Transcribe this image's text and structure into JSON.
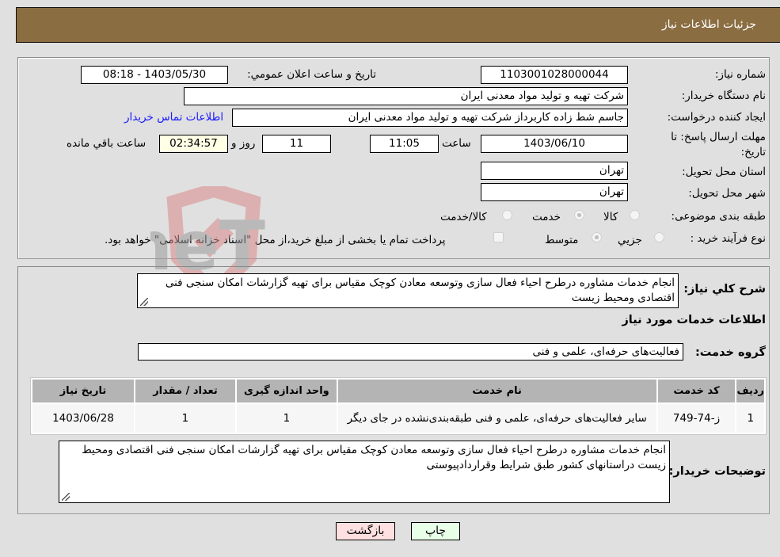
{
  "header": {
    "title": "جزئیات اطلاعات نیاز"
  },
  "fields": {
    "need_number": {
      "label": "شماره نیاز:",
      "value": "1103001028000044"
    },
    "announce_datetime": {
      "label": "تاریخ و ساعت اعلان عمومي:",
      "value": "1403/05/30 - 08:18"
    },
    "buyer_org": {
      "label": "نام دستگاه خریدار:",
      "value": "شرکت تهیه و تولید مواد معدنی ایران"
    },
    "creator": {
      "label": "ایجاد کننده درخواست:",
      "value": "جاسم شط زاده کاربرداز شرکت تهیه و تولید مواد معدنی ایران"
    },
    "buyer_contact_link": "اطلاعات تماس خریدار",
    "deadline": {
      "label": "مهلت ارسال پاسخ: تا تاریخ:",
      "date": "1403/06/10",
      "time_label": "ساعت",
      "time": "11:05",
      "days": "11",
      "days_label": "روز و",
      "remaining": "02:34:57",
      "remaining_label": "ساعت باقي مانده"
    },
    "province": {
      "label": "استان محل تحویل:",
      "value": "تهران"
    },
    "city": {
      "label": "شهر محل تحویل:",
      "value": "تهران"
    },
    "category": {
      "label": "طبقه بندی موضوعی:",
      "options": [
        "کالا",
        "خدمت",
        "کالا/خدمت"
      ],
      "selected": "خدمت"
    },
    "purchase_type": {
      "label": "نوع فرآیند خرید :",
      "options": [
        "جزيي",
        "متوسط"
      ],
      "selected": "متوسط",
      "treasury_note": "پرداخت تمام یا بخشی از مبلغ خرید،از محل \"اسناد خزانه اسلامی\" خواهد بود."
    }
  },
  "description": {
    "label": "شرح کلي نياز:",
    "value": "انجام خدمات مشاوره درطرح احیاء فعال سازی وتوسعه معادن کوچک مقیاس برای تهیه گزارشات امکان سنجی فنی اقتصادی ومحیط زیست"
  },
  "services_section": {
    "title": "اطلاعات خدمات مورد نياز",
    "group_label": "گروه خدمت:",
    "group_value": "فعالیت‌های حرفه‌ای، علمی و فنی",
    "table": {
      "headers": [
        "ردیف",
        "کد خدمت",
        "نام خدمت",
        "واحد اندازه گیری",
        "تعداد / مقدار",
        "تاریخ نیاز"
      ],
      "rows": [
        [
          "1",
          "ز-74-749",
          "سایر فعالیت‌های حرفه‌ای، علمی و فنی طبقه‌بندی‌نشده در جای دیگر",
          "1",
          "1",
          "1403/06/28"
        ]
      ]
    }
  },
  "buyer_notes": {
    "label": "توضیحات خریدار:",
    "value": "انجام خدمات مشاوره درطرح احیاء فعال سازی وتوسعه معادن کوچک مقیاس برای تهیه گزارشات امکان سنجی فنی اقتصادی ومحیط زیست دراستانهای کشور طبق شرایط وقراردادپیوستی"
  },
  "buttons": {
    "print": "چاپ",
    "back": "بازگشت"
  },
  "watermark": "AriaTender.neT",
  "colors": {
    "header_bg": "#8b6d42",
    "back_bg": "#ffe0e0",
    "print_bg": "#e8ffe8",
    "link": "#1a1aff"
  }
}
